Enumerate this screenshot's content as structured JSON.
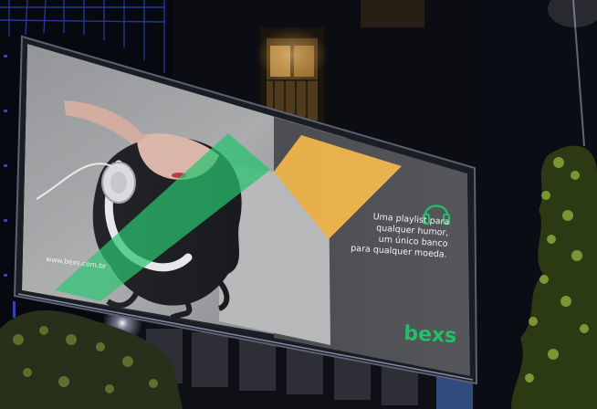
{
  "billboard": {
    "url": "www.bexs.com.br",
    "tagline_lines": [
      "Uma playlist para",
      "qualquer humor,",
      "um único banco",
      "para qualquer moeda."
    ],
    "logo": "bexs"
  },
  "icons": {
    "headphones": "headphones-icon"
  },
  "colors": {
    "brand_green": "#22c06b",
    "accent_yellow": "#e8b04a",
    "panel_gray": "#4d4e52",
    "photo_gray": "#b9bbbd",
    "night_sky": "#05070d"
  }
}
